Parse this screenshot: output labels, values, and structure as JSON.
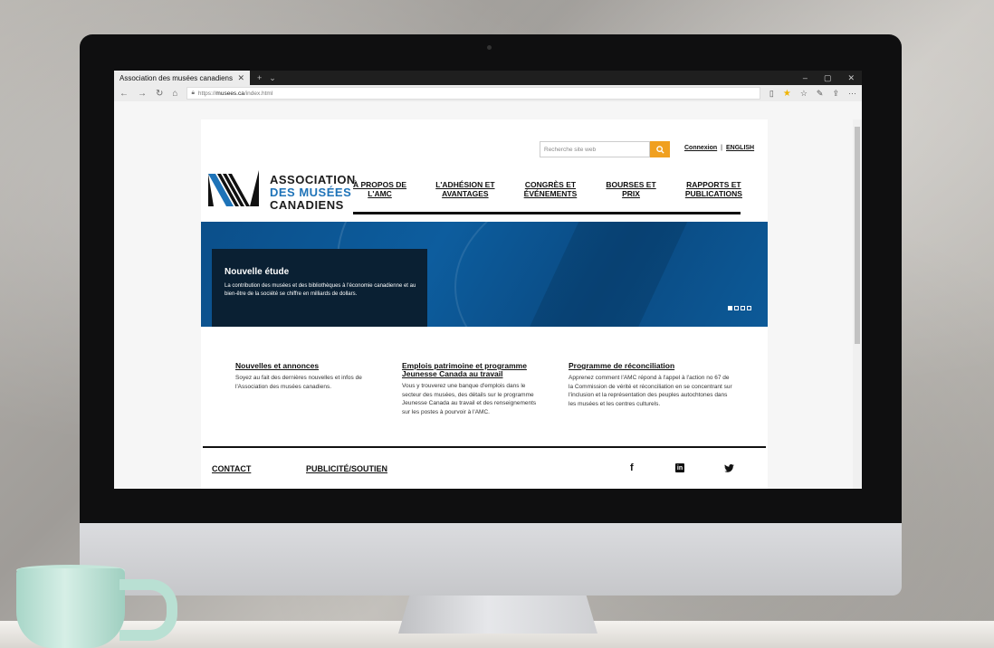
{
  "browser": {
    "tab_title": "Association des musées canadiens",
    "url_prefix": "https://",
    "url_domain": "musees.ca",
    "url_path": "/index.html"
  },
  "header": {
    "search_placeholder": "Recherche site web",
    "login": "Connexion",
    "separator": "|",
    "language": "ENGLISH"
  },
  "logo": {
    "line1": "ASSOCIATION",
    "line2": "DES MUSÉES",
    "line3": "CANADIENS"
  },
  "nav": [
    {
      "line1": "À PROPOS DE",
      "line2": "L'AMC"
    },
    {
      "line1": "L'ADHÉSION ET",
      "line2": "AVANTAGES"
    },
    {
      "line1": "CONGRÈS ET",
      "line2": "ÉVÉNEMENTS"
    },
    {
      "line1": "BOURSES ET",
      "line2": "PRIX"
    },
    {
      "line1": "RAPPORTS ET",
      "line2": "PUBLICATIONS"
    }
  ],
  "hero": {
    "title": "Nouvelle étude",
    "text": "La contribution des musées et des bibliothèques à l'économie canadienne et au bien-être de la société se chiffre en milliards de dollars."
  },
  "columns": [
    {
      "title": "Nouvelles et annonces",
      "text": "Soyez au fait des dernières nouvelles et infos de l'Association des musées canadiens."
    },
    {
      "title": "Emplois patrimoine et programme Jeunesse Canada au travail",
      "text": "Vous y trouverez une banque d'emplois dans le secteur des musées, des détails sur le programme Jeunesse Canada au travail et des renseignements sur les postes à pourvoir à l'AMC."
    },
    {
      "title": "Programme de réconciliation",
      "text": "Apprenez comment l'AMC répond à l'appel à l'action no 67 de la Commission de vérité et réconciliation en se concentrant sur l'inclusion et la représentation des peuples autochtones dans les musées et les centres culturels."
    }
  ],
  "footer": {
    "contact": "CONTACT",
    "ads": "PUBLICITÉ/SOUTIEN",
    "facebook": "f",
    "linkedin": "in",
    "twitter": "🐦"
  },
  "icons": {
    "search": "search-icon",
    "close": "close-icon"
  }
}
